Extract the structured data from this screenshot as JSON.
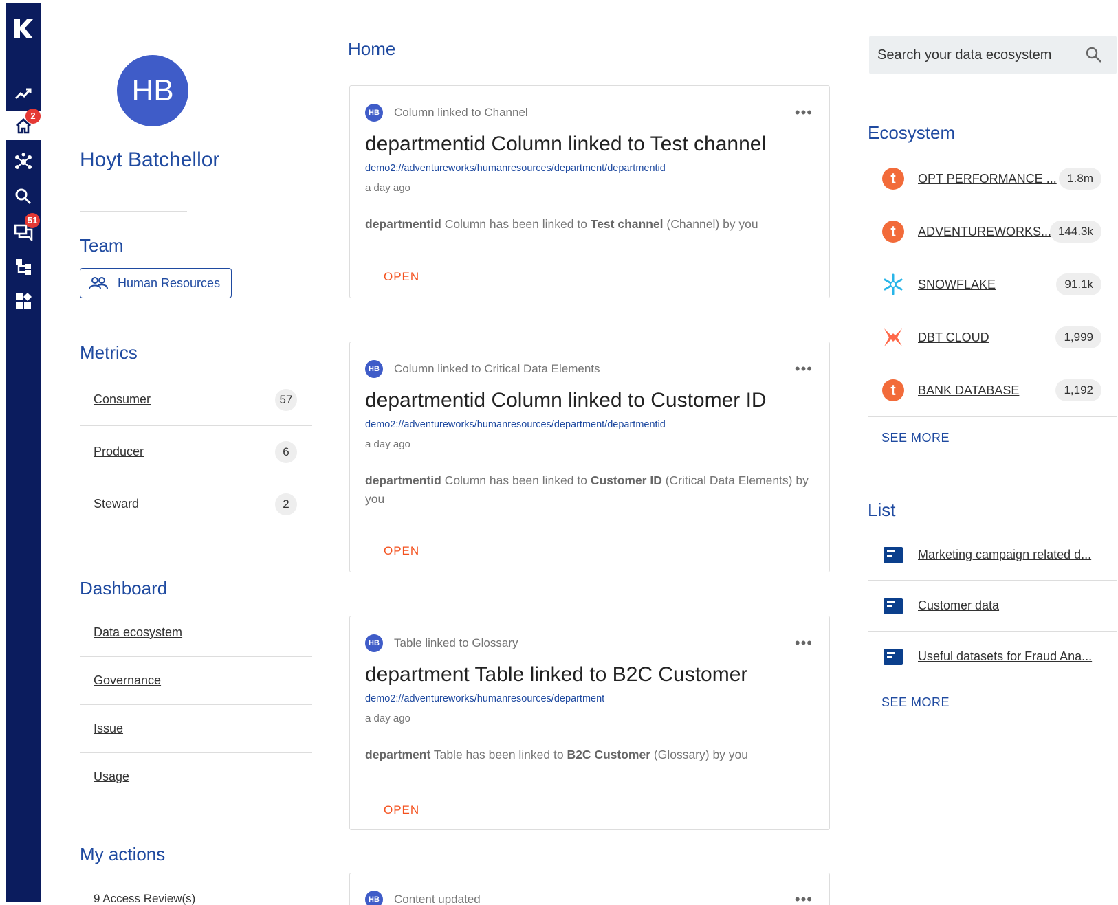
{
  "rail": {
    "logo": "K",
    "icons": [
      "trend-icon",
      "home-icon",
      "network-icon",
      "search-icon",
      "chat-icon",
      "hierarchy-icon",
      "dashboard-icon"
    ],
    "home_badge": "2",
    "chat_badge": "51"
  },
  "profile": {
    "initials": "HB",
    "name": "Hoyt Batchellor"
  },
  "team": {
    "title": "Team",
    "chip": "Human Resources"
  },
  "metrics": {
    "title": "Metrics",
    "items": [
      {
        "label": "Consumer",
        "count": "57"
      },
      {
        "label": "Producer",
        "count": "6"
      },
      {
        "label": "Steward",
        "count": "2"
      }
    ]
  },
  "dashboard": {
    "title": "Dashboard",
    "items": [
      "Data ecosystem",
      "Governance",
      "Issue",
      "Usage"
    ]
  },
  "my_actions": {
    "title": "My actions",
    "first_item": "9 Access Review(s)"
  },
  "home": {
    "title": "Home",
    "cards": [
      {
        "avatar": "HB",
        "type": "Column linked to Channel",
        "title": "departmentid Column linked to Test channel",
        "path": "demo2://adventureworks/humanresources/department/departmentid",
        "time": "a day ago",
        "desc_b1": "departmentid",
        "desc_t1": " Column has been linked to ",
        "desc_b2": "Test channel",
        "desc_t2": " (Channel) by you",
        "open": "OPEN"
      },
      {
        "avatar": "HB",
        "type": "Column linked to Critical Data Elements",
        "title": "departmentid Column linked to Customer ID",
        "path": "demo2://adventureworks/humanresources/department/departmentid",
        "time": "a day ago",
        "desc_b1": "departmentid",
        "desc_t1": " Column has been linked to ",
        "desc_b2": "Customer ID",
        "desc_t2": " (Critical Data Elements) by you",
        "open": "OPEN"
      },
      {
        "avatar": "HB",
        "type": "Table linked to Glossary",
        "title": "department Table linked to B2C Customer",
        "path": "demo2://adventureworks/humanresources/department",
        "time": "a day ago",
        "desc_b1": "department",
        "desc_t1": " Table has been linked to ",
        "desc_b2": "B2C Customer",
        "desc_t2": " (Glossary) by you",
        "open": "OPEN"
      },
      {
        "avatar": "HB",
        "type": "Content updated"
      }
    ]
  },
  "search": {
    "placeholder": "Search your data ecosystem"
  },
  "ecosystem": {
    "title": "Ecosystem",
    "items": [
      {
        "name": "OPT PERFORMANCE ...",
        "count": "1.8m",
        "icon": "t-icon"
      },
      {
        "name": "ADVENTUREWORKS...",
        "count": "144.3k",
        "icon": "t-icon"
      },
      {
        "name": "SNOWFLAKE",
        "count": "91.1k",
        "icon": "snowflake-icon"
      },
      {
        "name": "DBT CLOUD",
        "count": "1,999",
        "icon": "dbt-icon"
      },
      {
        "name": "BANK DATABASE",
        "count": "1,192",
        "icon": "t-icon"
      }
    ],
    "see_more": "SEE MORE"
  },
  "lists": {
    "title": "List",
    "items": [
      "Marketing campaign related d...",
      "Customer data",
      "Useful datasets for Fraud Ana..."
    ],
    "see_more": "SEE MORE"
  },
  "colors": {
    "rail": "#0b1c5e",
    "accent": "#1f4aa0",
    "open": "#f4511e",
    "badge": "#e53935"
  }
}
